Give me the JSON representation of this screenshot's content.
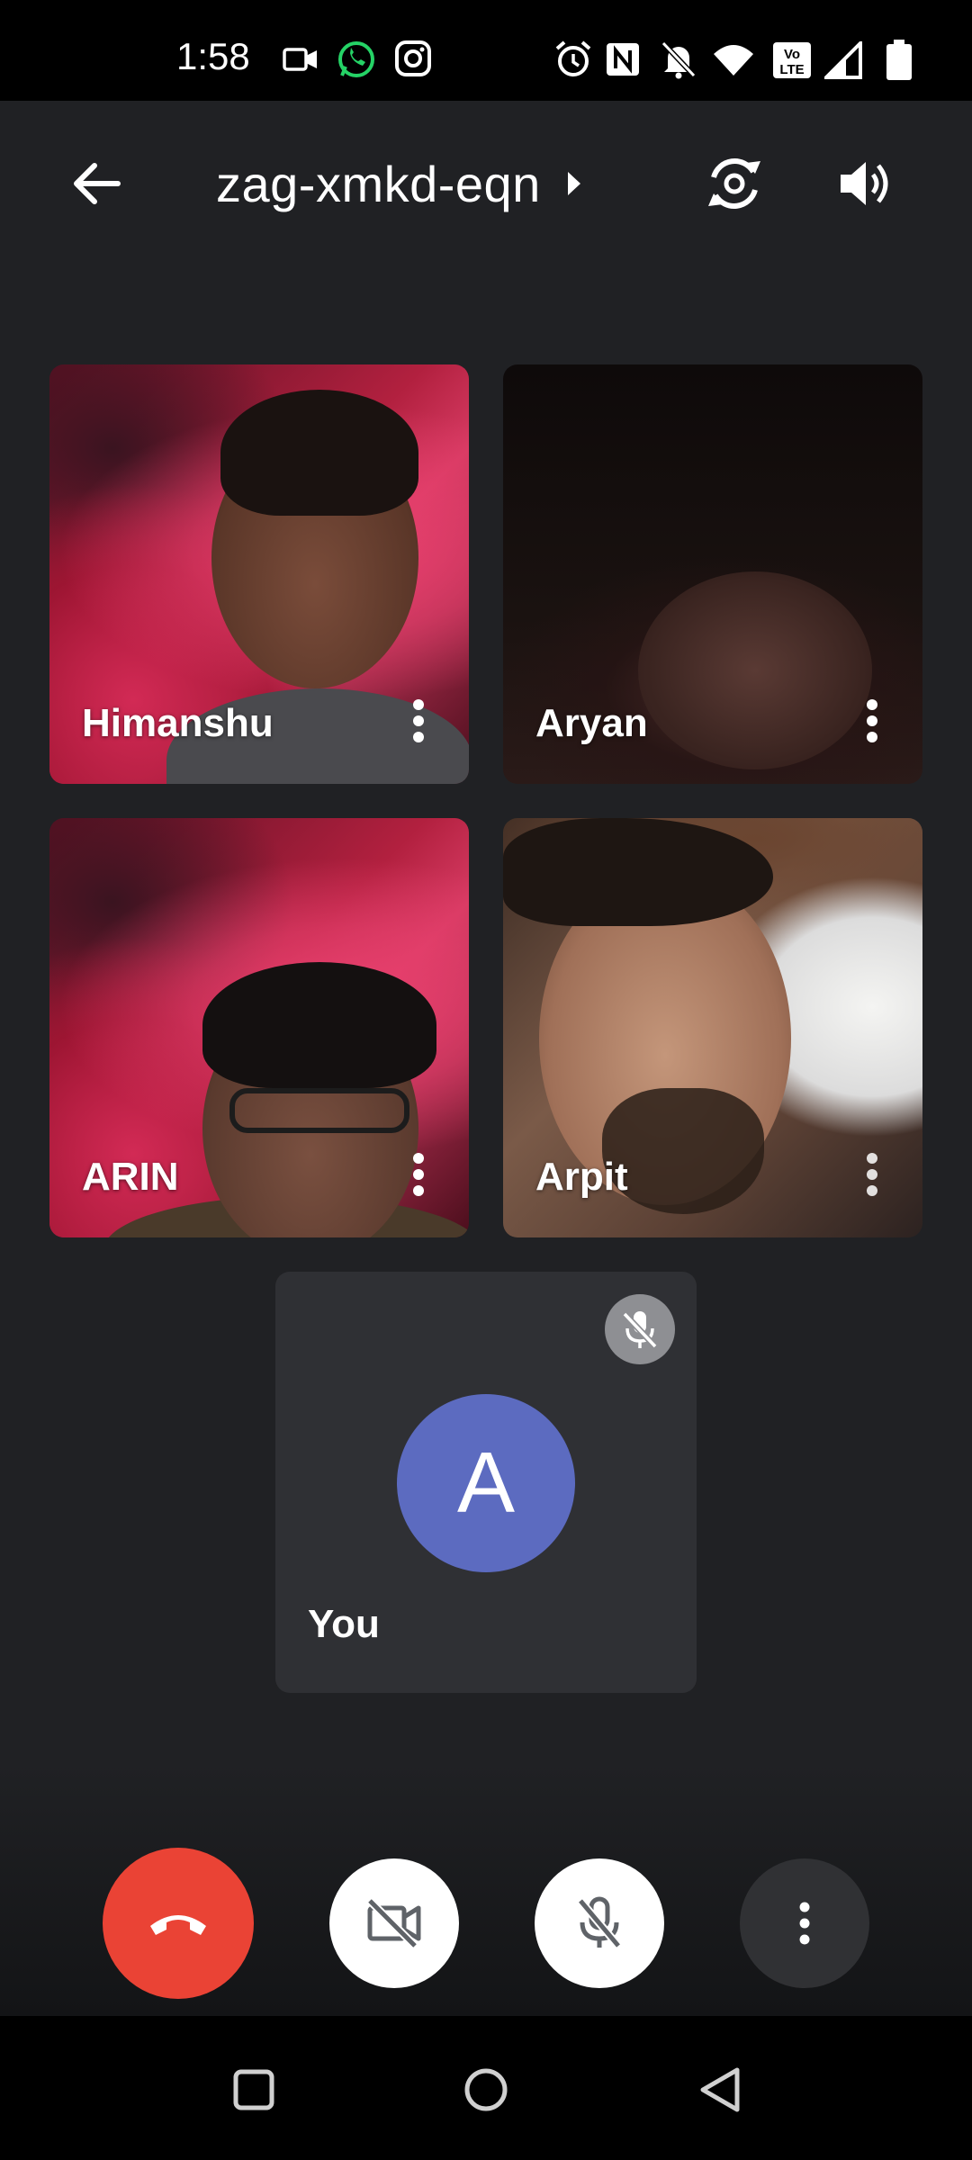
{
  "status_bar": {
    "time": "1:58",
    "left_icons": [
      "video-camera-icon",
      "whatsapp-icon",
      "instagram-icon"
    ],
    "right_icons": [
      "alarm-icon",
      "nfc-icon",
      "notifications-off-icon",
      "wifi-icon",
      "volte-icon",
      "signal-icon",
      "battery-icon"
    ]
  },
  "app_bar": {
    "meeting_code": "zag-xmkd-eqn",
    "back_icon": "arrow-back-icon",
    "caret_icon": "caret-right-icon",
    "flip_camera_icon": "flip-camera-icon",
    "audio_output_icon": "speaker-icon"
  },
  "participants": [
    {
      "name": "Himanshu"
    },
    {
      "name": "Aryan"
    },
    {
      "name": "ARIN"
    },
    {
      "name": "Arpit"
    }
  ],
  "self_tile": {
    "avatar_letter": "A",
    "name": "You",
    "mic_muted": true,
    "avatar_color": "#5c6bc0"
  },
  "controls": {
    "end_call_color": "#ea4335",
    "camera": "off",
    "microphone": "off"
  },
  "nav_bar": {
    "icons": [
      "recents-icon",
      "home-icon",
      "back-triangle-icon"
    ]
  }
}
